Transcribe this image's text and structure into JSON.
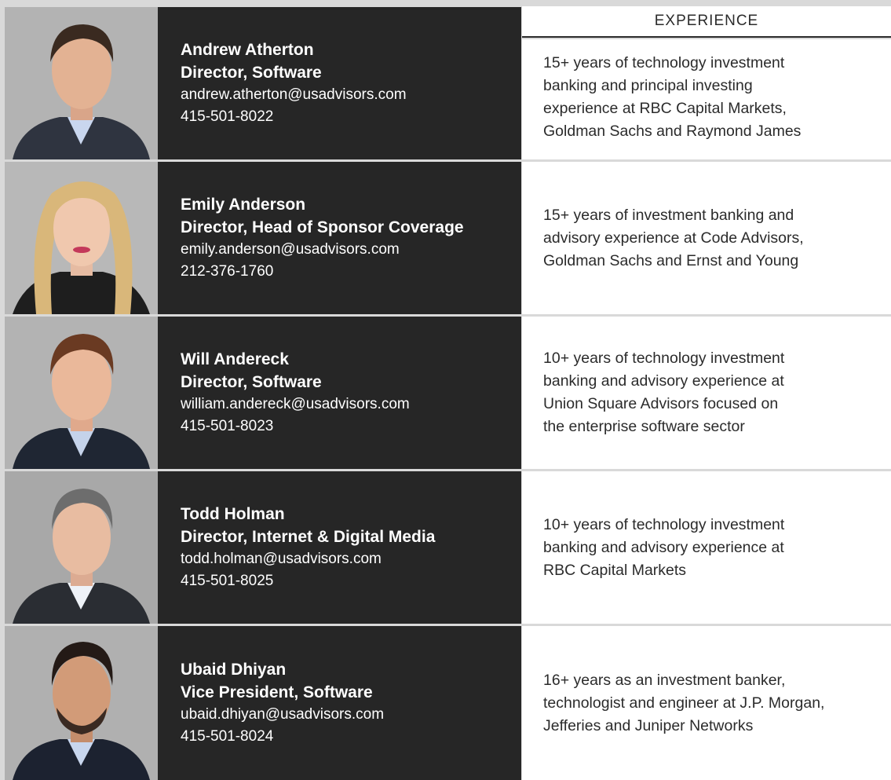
{
  "header": {
    "experience_label": "EXPERIENCE"
  },
  "people": [
    {
      "name": "Andrew Atherton",
      "title": "Director, Software",
      "email": "andrew.atherton@usadvisors.com",
      "phone": "415-501-8022",
      "experience": [
        "15+ years of technology investment",
        "banking and principal investing",
        "experience at RBC Capital Markets,",
        "Goldman Sachs and Raymond James"
      ]
    },
    {
      "name": "Emily Anderson",
      "title": "Director, Head of Sponsor Coverage",
      "email": "emily.anderson@usadvisors.com",
      "phone": "212-376-1760",
      "experience": [
        "15+ years of investment banking and",
        "advisory experience at Code Advisors,",
        "Goldman Sachs and Ernst and Young"
      ]
    },
    {
      "name": "Will Andereck",
      "title": "Director, Software",
      "email": "william.andereck@usadvisors.com",
      "phone": "415-501-8023",
      "experience": [
        "10+ years of technology investment",
        "banking and advisory experience at",
        "Union Square Advisors focused on",
        "the enterprise software sector"
      ]
    },
    {
      "name": "Todd Holman",
      "title": "Director, Internet & Digital Media",
      "email": "todd.holman@usadvisors.com",
      "phone": "415-501-8025",
      "experience": [
        "10+ years of technology investment",
        "banking and advisory experience at",
        "RBC Capital Markets"
      ]
    },
    {
      "name": "Ubaid Dhiyan",
      "title": "Vice President, Software",
      "email": "ubaid.dhiyan@usadvisors.com",
      "phone": "415-501-8024",
      "experience": [
        "16+ years as an investment banker,",
        "technologist and engineer at J.P. Morgan,",
        "Jefferies and Juniper Networks"
      ]
    }
  ],
  "colors": {
    "info_background": "#262626",
    "experience_background": "#ffffff",
    "page_background": "#d9d9d9"
  }
}
